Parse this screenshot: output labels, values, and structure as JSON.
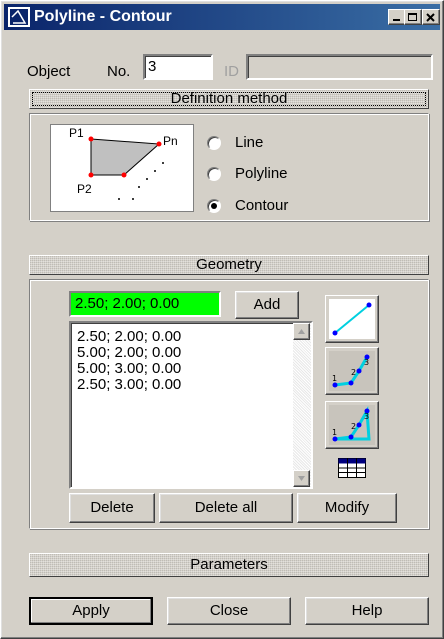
{
  "window": {
    "title": "Polyline - Contour"
  },
  "object": {
    "label": "Object",
    "no_label": "No.",
    "no_value": "3",
    "id_label": "ID",
    "id_value": ""
  },
  "definition": {
    "header": "Definition method",
    "diagram_labels": {
      "p1": "P1",
      "pn": "Pn",
      "p2": "P2"
    },
    "options": [
      {
        "label": "Line",
        "checked": false
      },
      {
        "label": "Polyline",
        "checked": false
      },
      {
        "label": "Contour",
        "checked": true
      }
    ]
  },
  "geometry": {
    "header": "Geometry",
    "input_value": "2.50; 2.00; 0.00",
    "add_label": "Add",
    "points": [
      "2.50; 2.00; 0.00",
      "5.00; 2.00; 0.00",
      "5.00; 3.00; 0.00",
      "2.50; 3.00; 0.00"
    ],
    "delete_label": "Delete",
    "delete_all_label": "Delete all",
    "modify_label": "Modify"
  },
  "parameters": {
    "header": "Parameters"
  },
  "footer": {
    "apply_label": "Apply",
    "close_label": "Close",
    "help_label": "Help"
  },
  "colors": {
    "accent_input": "#00ff00",
    "titlebar": "#0a246a",
    "diagram_point": "#ff0000",
    "tool_line": "#00d0e0"
  },
  "icons": [
    "polyline-app-icon",
    "minimize-icon",
    "maximize-icon",
    "close-icon",
    "line-tool-icon",
    "polyline-tool-icon",
    "contour-tool-icon",
    "table-icon",
    "scroll-up-icon",
    "scroll-down-icon"
  ]
}
